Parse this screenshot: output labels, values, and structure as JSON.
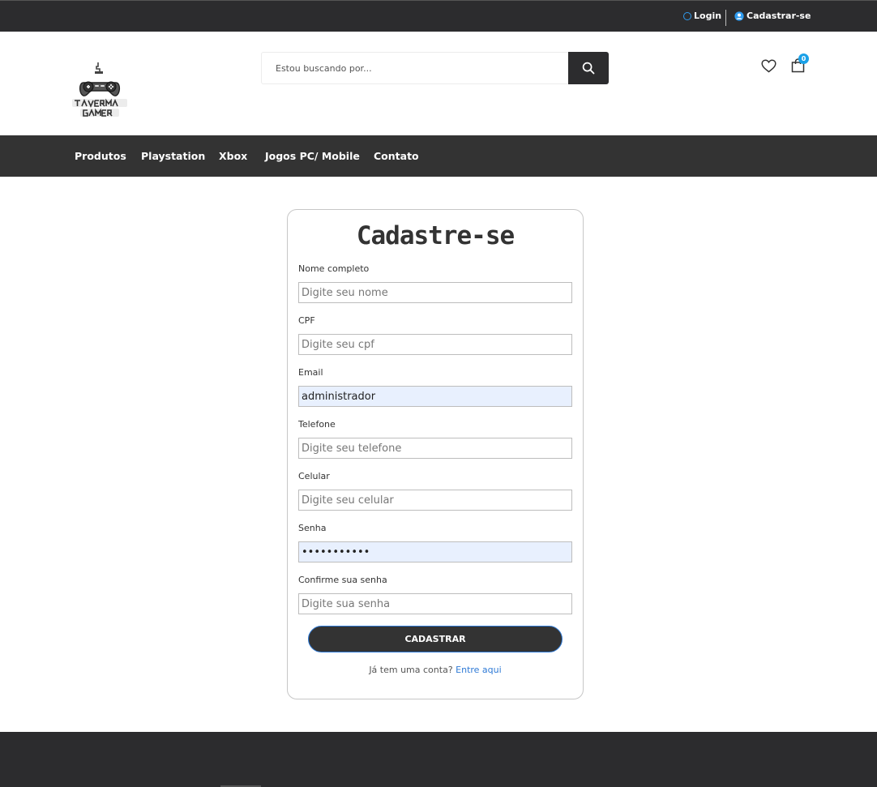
{
  "topbar": {
    "login_label": "Login",
    "register_label": "Cadastrar-se"
  },
  "header": {
    "search_placeholder": "Estou buscando por...",
    "cart_count": "0"
  },
  "nav": {
    "items": [
      "Produtos",
      "Playstation",
      "Xbox",
      "Jogos PC/ Mobile",
      "Contato"
    ]
  },
  "form": {
    "title": "Cadastre-se",
    "fields": [
      {
        "label": "Nome completo",
        "placeholder": "Digite seu nome",
        "value": ""
      },
      {
        "label": "CPF",
        "placeholder": "Digite seu cpf",
        "value": ""
      },
      {
        "label": "Email",
        "placeholder": "",
        "value": "administrador"
      },
      {
        "label": "Telefone",
        "placeholder": "Digite seu telefone",
        "value": ""
      },
      {
        "label": "Celular",
        "placeholder": "Digite seu celular",
        "value": ""
      },
      {
        "label": "Senha",
        "placeholder": "",
        "value": "•••••••••••"
      },
      {
        "label": "Confirme sua senha",
        "placeholder": "Digite sua senha",
        "value": ""
      }
    ],
    "submit_label": "CADASTRAR",
    "account_question": "Já tem uma conta?",
    "account_link": "Entre aqui"
  },
  "colors": {
    "dark_bar": "#2c2c2e",
    "nav_bar": "#333333",
    "accent_blue": "#1aa1e8",
    "link_blue": "#2f7ad6",
    "autofill_bg": "#e8f0fe"
  }
}
